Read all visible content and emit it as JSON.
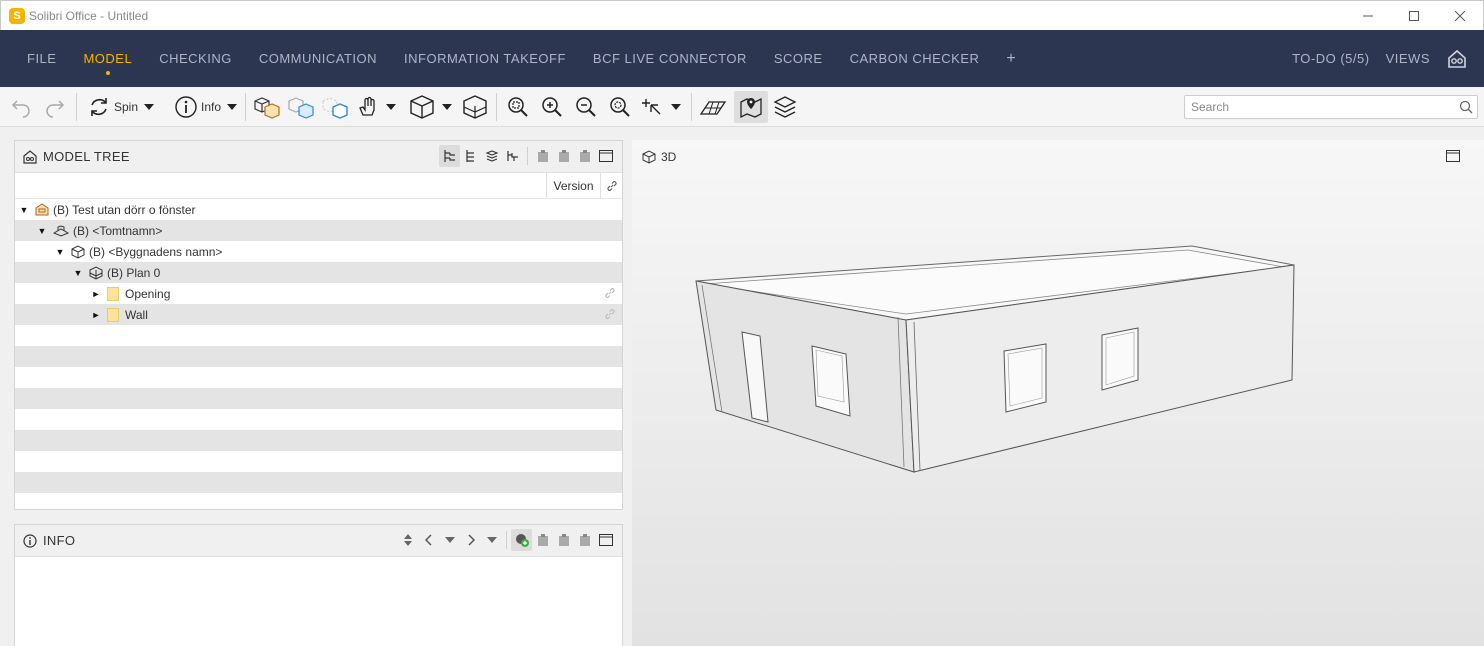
{
  "window": {
    "logo_letter": "S",
    "title": "Solibri Office - Untitled"
  },
  "menu": {
    "items": [
      "FILE",
      "MODEL",
      "CHECKING",
      "COMMUNICATION",
      "INFORMATION TAKEOFF",
      "BCF LIVE CONNECTOR",
      "SCORE",
      "CARBON CHECKER",
      "+"
    ],
    "active": "MODEL",
    "todo_label": "TO-DO (5/5)",
    "views_label": "VIEWS"
  },
  "toolbar": {
    "spin_label": "Spin",
    "info_label": "Info",
    "search_placeholder": "Search"
  },
  "model_tree": {
    "title": "MODEL TREE",
    "columns": {
      "version": "Version"
    },
    "rows": [
      {
        "label": "(B) Test utan dörr o fönster",
        "icon": "project-icon",
        "depth": 0,
        "expanded": true
      },
      {
        "label": "(B) <Tomtnamn>",
        "icon": "site-icon",
        "depth": 1,
        "expanded": true
      },
      {
        "label": "(B) <Byggnadens namn>",
        "icon": "building-icon",
        "depth": 2,
        "expanded": true
      },
      {
        "label": "(B) Plan 0",
        "icon": "storey-icon",
        "depth": 3,
        "expanded": true
      },
      {
        "label": "Opening",
        "icon": "folder-icon",
        "depth": 4,
        "expanded": false
      },
      {
        "label": "Wall",
        "icon": "folder-icon",
        "depth": 4,
        "expanded": false
      }
    ]
  },
  "info_panel": {
    "title": "INFO"
  },
  "view3d": {
    "title": "3D"
  },
  "colors": {
    "menu_bg": "#2d3650",
    "accent": "#f5b400",
    "menu_text": "#aeb5c7"
  }
}
